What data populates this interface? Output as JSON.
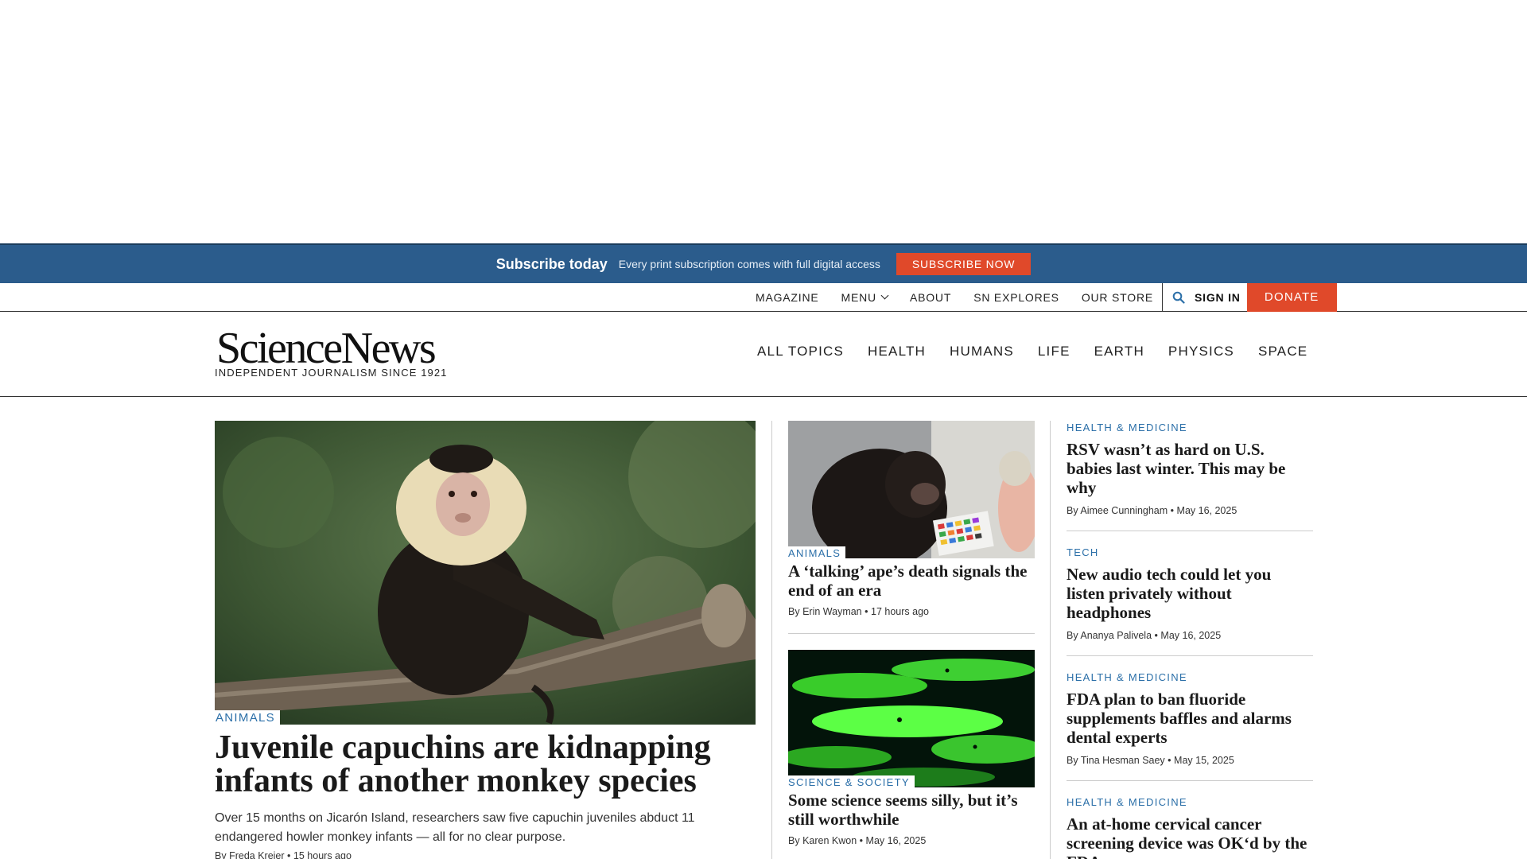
{
  "subscribe_bar": {
    "title": "Subscribe today",
    "text": "Every print subscription comes with full digital access",
    "button": "SUBSCRIBE NOW"
  },
  "utility_nav": {
    "links": [
      "MAGAZINE",
      "MENU",
      "ABOUT",
      "SN EXPLORES",
      "OUR STORE"
    ],
    "sign_in": "SIGN IN",
    "donate": "DONATE"
  },
  "masthead": {
    "logo": "ScienceNews",
    "tagline": "INDEPENDENT JOURNALISM SINCE 1921",
    "nav": [
      "ALL TOPICS",
      "HEALTH",
      "HUMANS",
      "LIFE",
      "EARTH",
      "PHYSICS",
      "SPACE"
    ]
  },
  "feature": {
    "category": "ANIMALS",
    "title": "Juvenile capuchins are kidnapping infants of another monkey species",
    "dek": "Over 15 months on Jicarón Island, researchers saw five capuchin juveniles abduct 11 endangered howler monkey infants — all for no clear purpose.",
    "byline_prefix": "By",
    "author": "Freda Kreier",
    "time": "15 hours ago"
  },
  "middle_stories": [
    {
      "category": "ANIMALS",
      "title": "A ‘talking’ ape’s death signals the end of an era",
      "author": "Erin Wayman",
      "time": "17 hours ago"
    },
    {
      "category": "SCIENCE & SOCIETY",
      "title": "Some science seems silly, but it’s still worthwhile",
      "author": "Karen Kwon",
      "time": "May 16, 2025"
    }
  ],
  "right_stories": [
    {
      "category": "HEALTH & MEDICINE",
      "title": "RSV wasn’t as hard on U.S. babies last winter. This may be why",
      "author": "Aimee Cunningham",
      "time": "May 16, 2025"
    },
    {
      "category": "TECH",
      "title": "New audio tech could let you listen privately without headphones",
      "author": "Ananya Palivela",
      "time": "May 16, 2025"
    },
    {
      "category": "HEALTH & MEDICINE",
      "title": "FDA plan to ban fluoride supplements baffles and alarms dental experts",
      "author": "Tina Hesman Saey",
      "time": "May 15, 2025"
    },
    {
      "category": "HEALTH & MEDICINE",
      "title": "An at-home cervical cancer screening device was OK‘d by the FDA",
      "author": "",
      "time": ""
    }
  ],
  "colors": {
    "subscribe_bar": "#2b5c8c",
    "accent_red": "#e0492a",
    "category_blue": "#2b6fa8"
  }
}
